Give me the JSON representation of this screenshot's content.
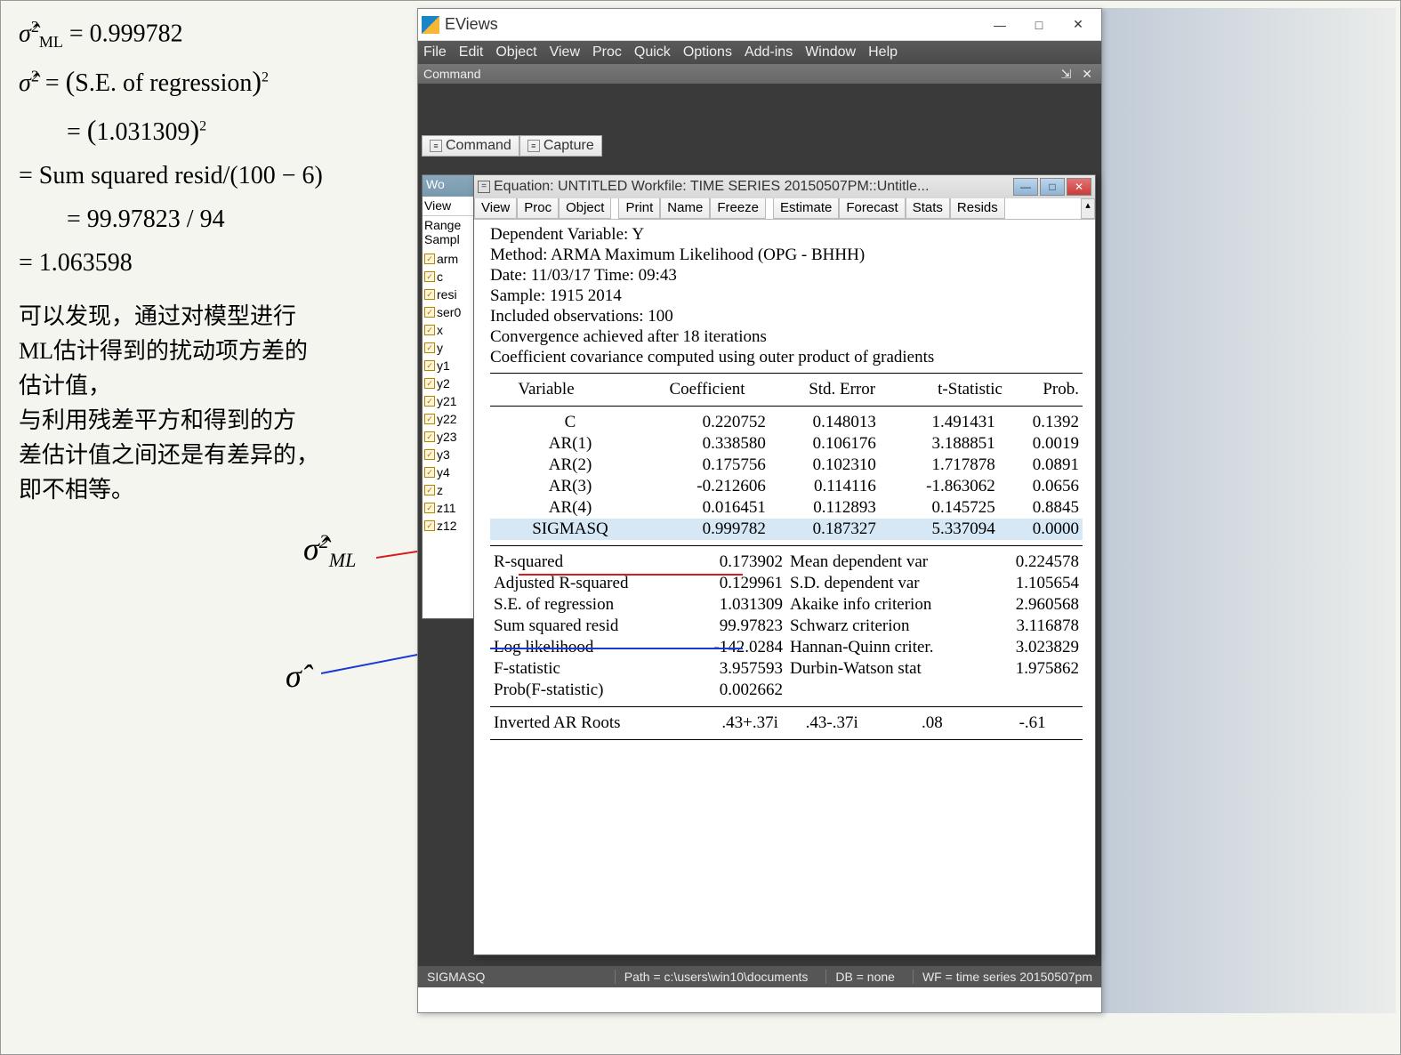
{
  "math": {
    "line1": "σ̂²_ML = 0.999782",
    "line2": "σ̂² = (S.E. of regression)²",
    "line3": "     = (1.031309)²",
    "line4": "= Sum squared resid/(100 − 6)",
    "line5": "     = 99.97823 / 94",
    "line6": "= 1.063598",
    "cn1": "可以发现，通过对模型进行",
    "cn2": "ML估计得到的扰动项方差的",
    "cn3": "估计值，",
    "cn4": "与利用残差平方和得到的方",
    "cn5": "差估计值之间还是有差异的，",
    "cn6": "即不相等。",
    "sigma_ml": "σ̂²_ML",
    "sigma": "σ̂"
  },
  "app": {
    "title": "EViews",
    "menus": [
      "File",
      "Edit",
      "Object",
      "View",
      "Proc",
      "Quick",
      "Options",
      "Add-ins",
      "Window",
      "Help"
    ],
    "command_label": "Command",
    "tool_tabs": [
      "Command",
      "Capture"
    ],
    "status": {
      "left": "SIGMASQ",
      "path": "Path = c:\\users\\win10\\documents",
      "db": "DB = none",
      "wf": "WF = time series 20150507pm"
    }
  },
  "wf": {
    "title": "Wo",
    "toolbar": "View",
    "range": "Range",
    "sample": "Sampl",
    "items": [
      "arm",
      "c",
      "resi",
      "ser0",
      "x",
      "y",
      "y1",
      "y2",
      "y21",
      "y22",
      "y23",
      "y3",
      "y4",
      "z",
      "z11",
      "z12"
    ]
  },
  "eq": {
    "title": "Equation: UNTITLED   Workfile: TIME SERIES 20150507PM::Untitle...",
    "toolbar": [
      "View",
      "Proc",
      "Object",
      "Print",
      "Name",
      "Freeze",
      "Estimate",
      "Forecast",
      "Stats",
      "Resids"
    ],
    "header": [
      "Dependent Variable: Y",
      "Method: ARMA Maximum Likelihood (OPG - BHHH)",
      "Date: 11/03/17   Time: 09:43",
      "Sample: 1915 2014",
      "Included observations: 100",
      "Convergence achieved after 18 iterations",
      "Coefficient covariance computed using outer product of gradients"
    ],
    "col_headers": [
      "Variable",
      "Coefficient",
      "Std. Error",
      "t-Statistic",
      "Prob."
    ],
    "rows": [
      {
        "var": "C",
        "coef": "0.220752",
        "se": "0.148013",
        "t": "1.491431",
        "p": "0.1392"
      },
      {
        "var": "AR(1)",
        "coef": "0.338580",
        "se": "0.106176",
        "t": "3.188851",
        "p": "0.0019"
      },
      {
        "var": "AR(2)",
        "coef": "0.175756",
        "se": "0.102310",
        "t": "1.717878",
        "p": "0.0891"
      },
      {
        "var": "AR(3)",
        "coef": "-0.212606",
        "se": "0.114116",
        "t": "-1.863062",
        "p": "0.0656"
      },
      {
        "var": "AR(4)",
        "coef": "0.016451",
        "se": "0.112893",
        "t": "0.145725",
        "p": "0.8845"
      },
      {
        "var": "SIGMASQ",
        "coef": "0.999782",
        "se": "0.187327",
        "t": "5.337094",
        "p": "0.0000"
      }
    ],
    "stats_left": [
      {
        "lbl": "R-squared",
        "val": "0.173902"
      },
      {
        "lbl": "Adjusted R-squared",
        "val": "0.129961"
      },
      {
        "lbl": "S.E. of regression",
        "val": "1.031309"
      },
      {
        "lbl": "Sum squared resid",
        "val": "99.97823"
      },
      {
        "lbl": "Log likelihood",
        "val": "-142.0284"
      },
      {
        "lbl": "F-statistic",
        "val": "3.957593"
      },
      {
        "lbl": "Prob(F-statistic)",
        "val": "0.002662"
      }
    ],
    "stats_right": [
      {
        "lbl": "Mean dependent var",
        "val": "0.224578"
      },
      {
        "lbl": "S.D. dependent var",
        "val": "1.105654"
      },
      {
        "lbl": "Akaike info criterion",
        "val": "2.960568"
      },
      {
        "lbl": "Schwarz criterion",
        "val": "3.116878"
      },
      {
        "lbl": "Hannan-Quinn criter.",
        "val": "3.023829"
      },
      {
        "lbl": "Durbin-Watson stat",
        "val": "1.975862"
      },
      {
        "lbl": "",
        "val": ""
      }
    ],
    "roots_label": "Inverted AR Roots",
    "roots": [
      ".43+.37i",
      ".43-.37i",
      ".08",
      "-.61"
    ]
  }
}
